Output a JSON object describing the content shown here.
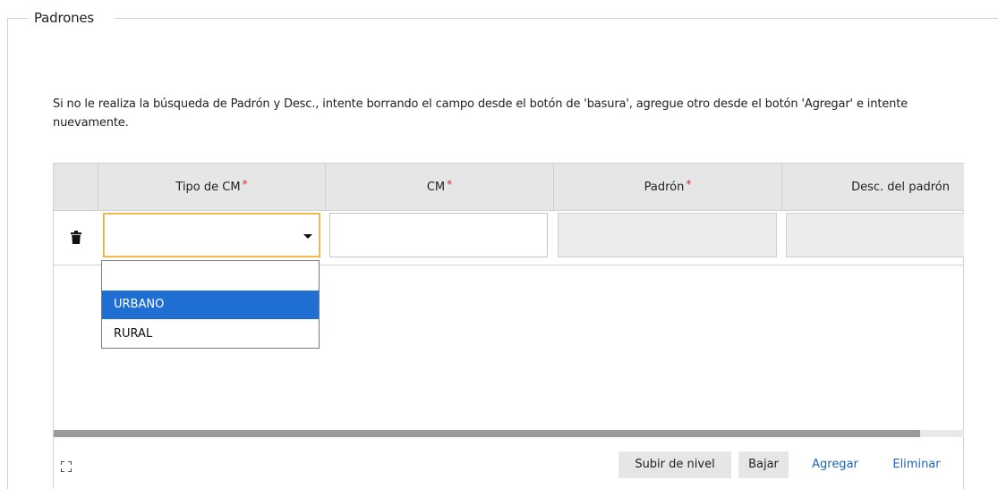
{
  "section": {
    "legend": "Padrones",
    "info_text": "Si no le realiza la búsqueda de Padrón y Desc., intente borrando el campo desde el botón de 'basura', agregue otro desde el botón 'Agregar' e intente nuevamente."
  },
  "grid": {
    "columns": [
      {
        "label": "Tipo de CM",
        "required": "*"
      },
      {
        "label": "CM",
        "required": "*"
      },
      {
        "label": "Padrón",
        "required": "*"
      },
      {
        "label": "Desc. del padrón",
        "required": ""
      }
    ],
    "row": {
      "tipo_cm_value": "",
      "cm_value": "",
      "padron_value": "",
      "desc_value": ""
    },
    "dropdown_options": [
      {
        "label": "",
        "selected": false
      },
      {
        "label": "URBANO",
        "selected": true
      },
      {
        "label": "RURAL",
        "selected": false
      }
    ]
  },
  "footer": {
    "subir_label": "Subir de nivel",
    "bajar_label": "Bajar",
    "agregar_label": "Agregar",
    "eliminar_label": "Eliminar"
  },
  "icons": {
    "trash": "trash-icon",
    "expand": "expand-icon",
    "caret": "chevron-down-icon"
  },
  "colors": {
    "required": "#d9262c",
    "selected_option": "#1f6fd2",
    "focus_border": "#f0b040",
    "link": "#1e62b8"
  }
}
